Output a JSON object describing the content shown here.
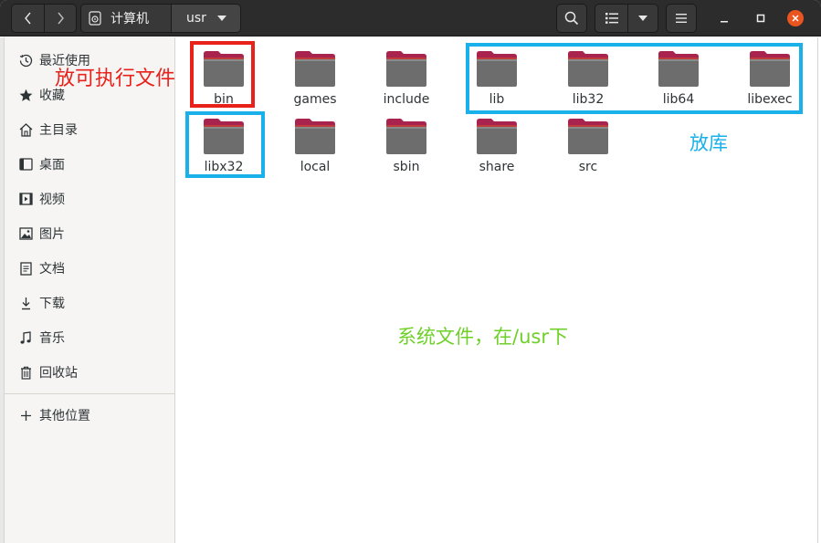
{
  "header": {
    "path": [
      {
        "label": "计算机",
        "icon": "drive-icon"
      },
      {
        "label": "usr",
        "icon": "chevron-down-icon"
      }
    ],
    "buttons": {
      "back": "chevron-left-icon",
      "forward": "chevron-right-icon",
      "search": "search-icon",
      "view_list": "list-view-icon",
      "view_options": "chevron-down-icon",
      "menu": "hamburger-menu-icon",
      "minimize": "minimize-icon",
      "maximize": "maximize-icon",
      "close": "close-icon"
    },
    "close_color": "#e95420"
  },
  "sidebar": {
    "items": [
      {
        "label": "最近使用",
        "icon": "clock-icon"
      },
      {
        "label": "收藏",
        "icon": "star-icon"
      },
      {
        "label": "主目录",
        "icon": "home-icon"
      },
      {
        "label": "桌面",
        "icon": "desktop-icon"
      },
      {
        "label": "视频",
        "icon": "video-icon"
      },
      {
        "label": "图片",
        "icon": "picture-icon"
      },
      {
        "label": "文档",
        "icon": "document-icon"
      },
      {
        "label": "下载",
        "icon": "download-icon"
      },
      {
        "label": "音乐",
        "icon": "music-icon"
      },
      {
        "label": "回收站",
        "icon": "trash-icon"
      }
    ],
    "other_locations": {
      "label": "其他位置",
      "icon": "plus-icon"
    }
  },
  "folders": [
    {
      "name": "bin"
    },
    {
      "name": "games"
    },
    {
      "name": "include"
    },
    {
      "name": "lib"
    },
    {
      "name": "lib32"
    },
    {
      "name": "lib64"
    },
    {
      "name": "libexec"
    },
    {
      "name": "libx32"
    },
    {
      "name": "local"
    },
    {
      "name": "sbin"
    },
    {
      "name": "share"
    },
    {
      "name": "src"
    }
  ],
  "annotations": {
    "executables": {
      "text": "放可执行文件",
      "color": "#e8211b"
    },
    "libraries": {
      "text": "放库",
      "color": "#1ab0ea"
    },
    "system_files": {
      "text": "系统文件，在/usr下",
      "color": "#6ed028"
    }
  },
  "colors": {
    "folder_tab": "#a8234e",
    "folder_body": "#6d6d6d",
    "headerbar": "#2c2c2c"
  }
}
